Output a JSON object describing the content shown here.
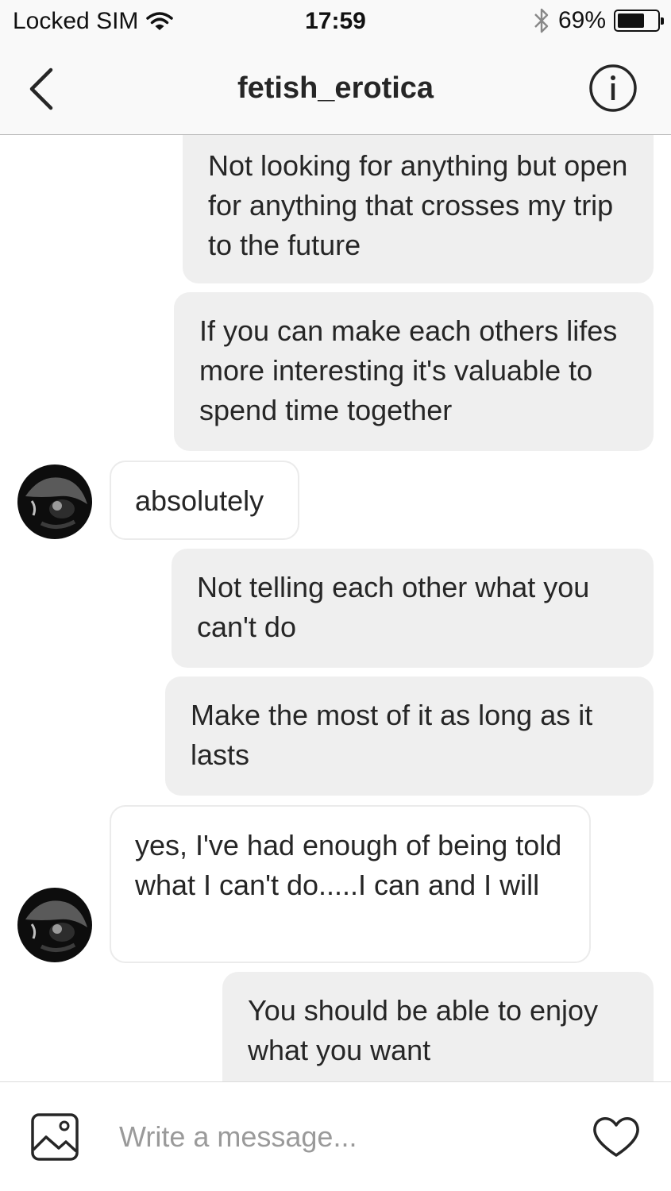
{
  "status_bar": {
    "carrier": "Locked SIM",
    "time": "17:59",
    "battery": "69%",
    "battery_level": 0.69
  },
  "header": {
    "title": "fetish_erotica",
    "back_icon": "chevron-left-icon",
    "info_icon": "info-circle-icon"
  },
  "messages": [
    {
      "from": "me",
      "text": "Not looking for anything but open for anything that crosses my trip to the future"
    },
    {
      "from": "me",
      "text": "If you can make each others lifes more interesting it's valuable to spend time together"
    },
    {
      "from": "them",
      "text": "absolutely"
    },
    {
      "from": "me",
      "text": "Not telling each other what you can't do"
    },
    {
      "from": "me",
      "text": "Make the most of it as long as it lasts"
    },
    {
      "from": "them",
      "text": "yes, I've had enough of being told what I can't do.....I can and I will"
    },
    {
      "from": "me",
      "text": "You should be able to enjoy what you want"
    }
  ],
  "composer": {
    "placeholder": "Write a message...",
    "gallery_icon": "image-icon",
    "like_icon": "heart-icon"
  },
  "colors": {
    "outgoing_bubble": "#efefef",
    "incoming_border": "#ebebeb",
    "text": "#262626",
    "placeholder": "#9a9a9a"
  }
}
